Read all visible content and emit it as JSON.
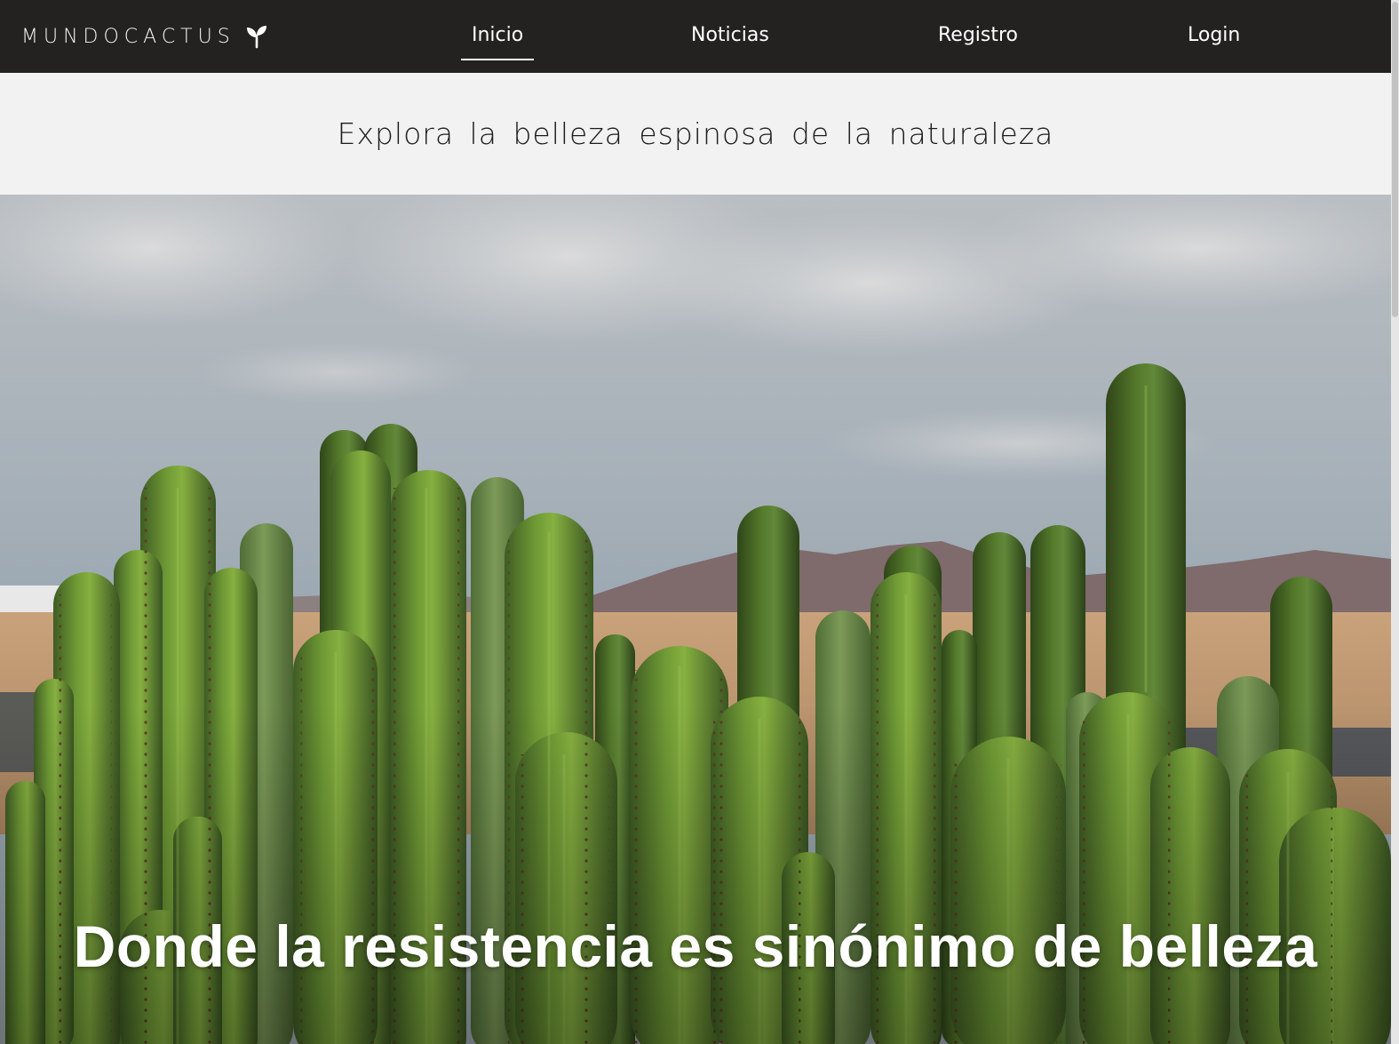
{
  "brand": {
    "name": "MUNDOCACTUS",
    "icon": "sprout-icon"
  },
  "nav": {
    "items": [
      {
        "label": "Inicio",
        "active": true
      },
      {
        "label": "Noticias",
        "active": false
      },
      {
        "label": "Registro",
        "active": false
      },
      {
        "label": "Login",
        "active": false
      }
    ]
  },
  "tagline": "Explora la belleza espinosa de la naturaleza",
  "hero": {
    "title": "Donde la resistencia es sinónimo de belleza"
  },
  "colors": {
    "navbar_bg": "#232221",
    "band_bg": "#f2f2f2",
    "text_light": "#ffffff",
    "cactus_green": "#5f8a2e"
  }
}
